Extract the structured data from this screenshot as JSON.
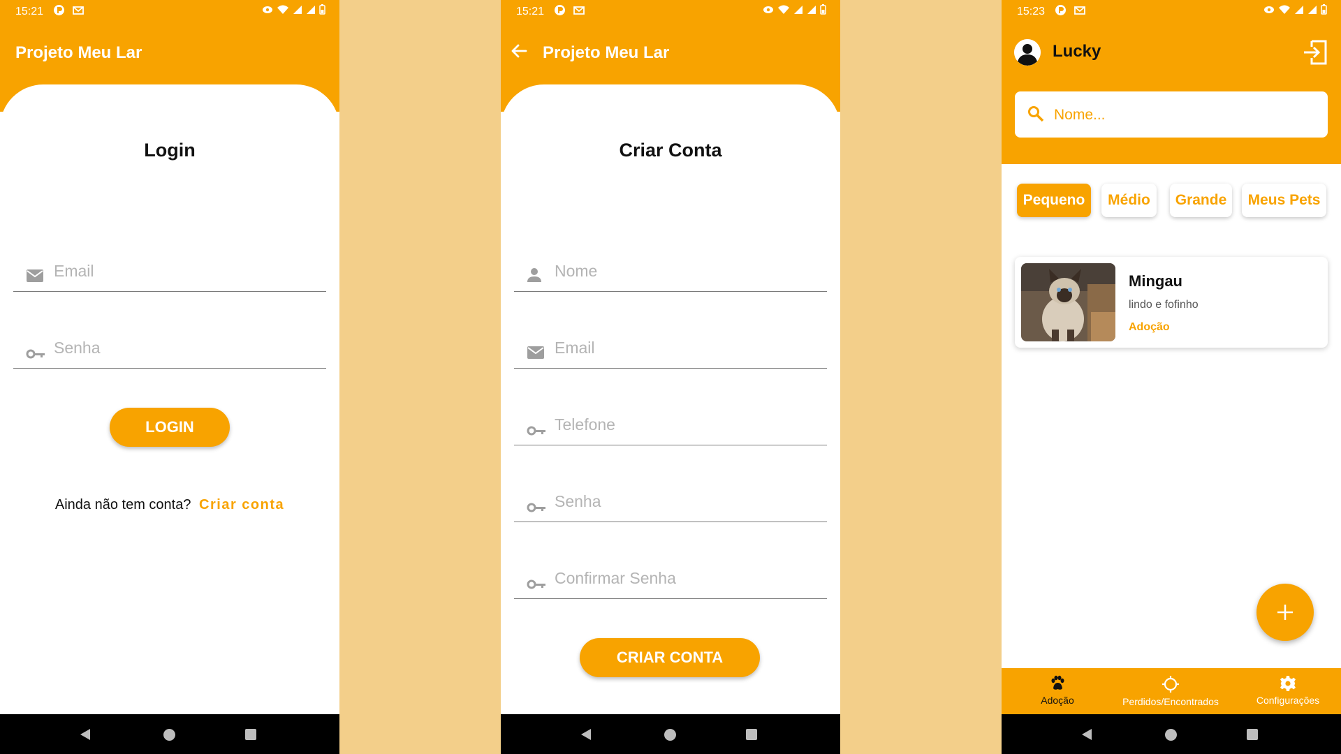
{
  "colors": {
    "accent": "#F8A300",
    "background": "#F3CF8A",
    "white": "#FFFFFF"
  },
  "status_bars": {
    "login": {
      "time": "15:21"
    },
    "register": {
      "time": "15:21"
    },
    "home": {
      "time": "15:23"
    }
  },
  "login_screen": {
    "app_title": "Projeto Meu Lar",
    "heading": "Login",
    "email_placeholder": "Email",
    "password_placeholder": "Senha",
    "login_button": "LOGIN",
    "no_account_text": "Ainda não tem conta?",
    "create_account_link": "Criar conta"
  },
  "register_screen": {
    "app_title": "Projeto Meu Lar",
    "heading": "Criar Conta",
    "fields": {
      "name_placeholder": "Nome",
      "email_placeholder": "Email",
      "phone_placeholder": "Telefone",
      "password_placeholder": "Senha",
      "confirm_password_placeholder": "Confirmar Senha"
    },
    "submit_button": "CRIAR CONTA"
  },
  "home_screen": {
    "user_name": "Lucky",
    "search_placeholder": "Nome...",
    "filters": [
      {
        "label": "Pequeno",
        "active": true
      },
      {
        "label": "Médio",
        "active": false
      },
      {
        "label": "Grande",
        "active": false
      },
      {
        "label": "Meus Pets",
        "active": false
      }
    ],
    "pets": [
      {
        "name": "Mingau",
        "description": "lindo e fofinho",
        "tag": "Adoção"
      }
    ],
    "bottom_nav": [
      {
        "label": "Adoção",
        "icon": "paw-icon",
        "active": true
      },
      {
        "label": "Perdidos/Encontrados",
        "icon": "crosshair-icon",
        "active": false
      },
      {
        "label": "Configurações",
        "icon": "gear-icon",
        "active": false
      }
    ]
  }
}
